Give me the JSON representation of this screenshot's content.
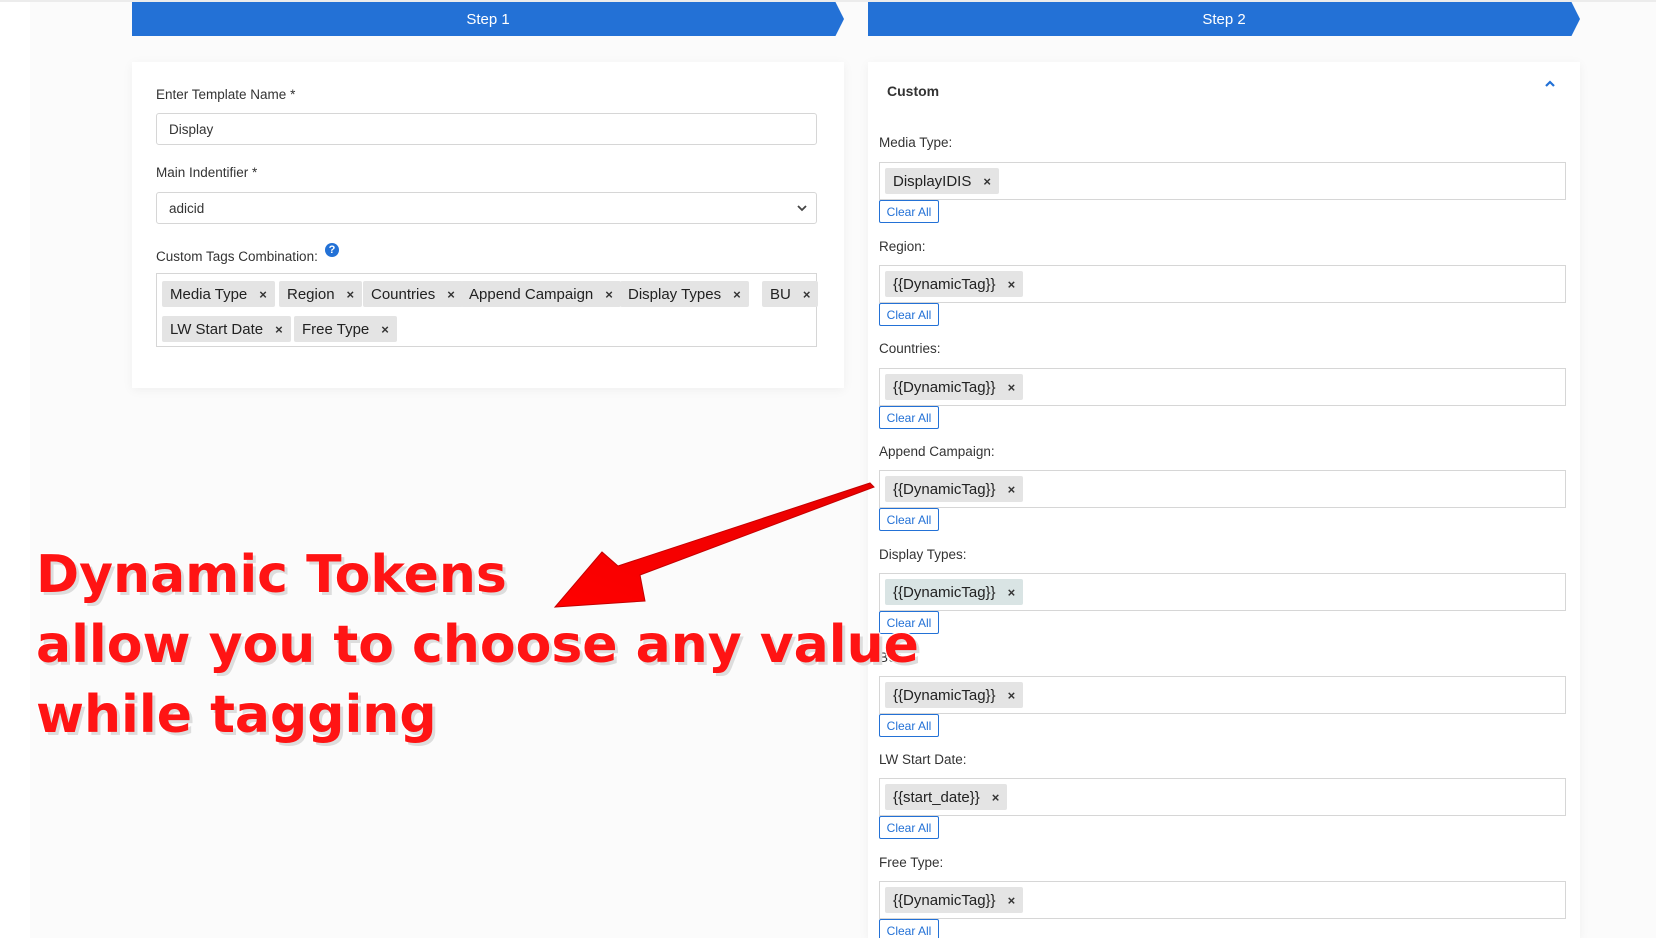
{
  "steps": {
    "step1": "Step 1",
    "step2": "Step 2"
  },
  "form": {
    "template_name_label": "Enter Template Name *",
    "template_name_value": "Display",
    "main_identifier_label": "Main Indentifier *",
    "main_identifier_value": "adicid",
    "custom_tags_label": "Custom Tags Combination:",
    "help_icon": "?",
    "tags": [
      "Media Type",
      "Region",
      "Countries",
      "Append Campaign",
      "Display Types",
      "BU",
      "LW Start Date",
      "Free Type"
    ]
  },
  "custom": {
    "title": "Custom",
    "clear_all": "Clear All",
    "remove_glyph": "×",
    "fields": [
      {
        "label": "Media Type:",
        "value": "DisplayIDIS"
      },
      {
        "label": "Region:",
        "value": "{{DynamicTag}}"
      },
      {
        "label": "Countries:",
        "value": "{{DynamicTag}}"
      },
      {
        "label": "Append Campaign:",
        "value": "{{DynamicTag}}"
      },
      {
        "label": "Display Types:",
        "value": "{{DynamicTag}}"
      },
      {
        "label": "BU:",
        "value": "{{DynamicTag}}"
      },
      {
        "label": "LW Start Date:",
        "value": "{{start_date}}"
      },
      {
        "label": "Free Type:",
        "value": "{{DynamicTag}}"
      }
    ]
  },
  "annotation": {
    "line1": "Dynamic Tokens",
    "line2": "allow you to choose any value",
    "line3": "while tagging"
  },
  "colors": {
    "accent": "#2371d6",
    "annotation": "#ff1414"
  }
}
